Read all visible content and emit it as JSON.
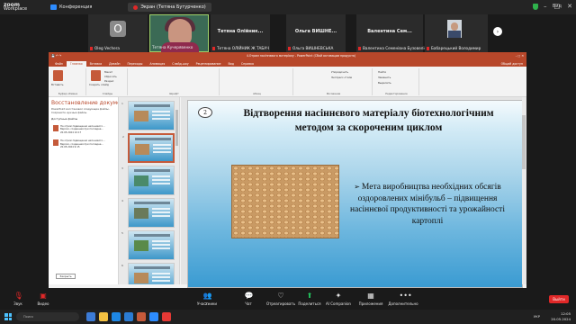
{
  "zoom": {
    "brand_line1": "zoom",
    "brand_line2": "Workplace",
    "tab_label": "Конференция",
    "share_label": "Экран (Тетяна Бутурченко)",
    "view_label": "Вид"
  },
  "participants": [
    {
      "name": "Oleg Vechera",
      "avatar_letter": "O"
    },
    {
      "name": "Тетяна Кучерявенко"
    },
    {
      "name": "Тетяна ОЛІЙНИК Ж ТАБАЧ",
      "big_name": "Тетяна Олійник..."
    },
    {
      "name": "Ольга ВИШНЕВСЬКА",
      "big_name": "Ольга ВИШНЕ..."
    },
    {
      "name": "Валентина Семенівна Бузовеліс...",
      "big_name": "Валентина Сем..."
    },
    {
      "name": "Бабарецький Володимир"
    }
  ],
  "ppt": {
    "window_title": "4.Отрим насіннєвого матеріалу - PowerPoint (Сбой активации продукта)",
    "tabs": [
      "Файл",
      "Главная",
      "Вставка",
      "Дизайн",
      "Переходы",
      "Анимация",
      "Слайд-шоу",
      "Рецензирование",
      "Вид",
      "Справка"
    ],
    "tabs_right": "Общий доступ",
    "ribbon": {
      "paste": "Вставить",
      "create_slide": "Создать слайд",
      "clipboard": "Буфер обмена",
      "slides": "Слайды",
      "font": "Шрифт",
      "paragraph": "Абзац",
      "drawing": "Рисование",
      "editing": "Редактирование",
      "find": "Найти",
      "replace": "Заменить",
      "select": "Выделить",
      "layout": "Макет",
      "reset": "Сбросить",
      "section": "Раздел",
      "arrange": "Упорядочить",
      "styles": "Экспресс-стили"
    },
    "recovery": {
      "heading": "Восстановление докуме...",
      "description": "PowerPoint восстановил следующие файлы. Сохраните нужные файлы.",
      "available_label": "Доступные файлы",
      "files": [
        {
          "name": "На отрим підвищення насіннєвого...",
          "type": "Версия, созданная при последне...",
          "date": "20.05.2024 10:17"
        },
        {
          "name": "На отрим підвищення насіннєвого...",
          "type": "Версия, созданная при последне...",
          "date": "20.05.2024 9:15"
        }
      ],
      "close_label": "Закрыть"
    },
    "thumb_numbers": [
      "1",
      "2",
      "3",
      "4",
      "5",
      "6",
      "7"
    ],
    "slide": {
      "number": "2",
      "title": "Відтворення насіннєвого матеріалу біотехнологічним методом за скороченим  циклом",
      "bullet_text": "Мета виробництва необхідних обсягів оздоровлених мінібульб – підвищення насіннєвої продуктивності та урожайності картоплі"
    }
  },
  "toolbar": {
    "audio": "Звук",
    "video": "Видео",
    "participants": "Участники",
    "participants_count": "21",
    "chat": "Чат",
    "reactions": "Отреагировать",
    "share": "Поделиться",
    "ai": "AI Companion",
    "apps": "Приложения",
    "more": "Дополнительно",
    "leave": "Выйти"
  },
  "taskbar": {
    "search_placeholder": "Поиск",
    "lang": "УКР",
    "time": "12:05",
    "date": "20.05.2024"
  }
}
